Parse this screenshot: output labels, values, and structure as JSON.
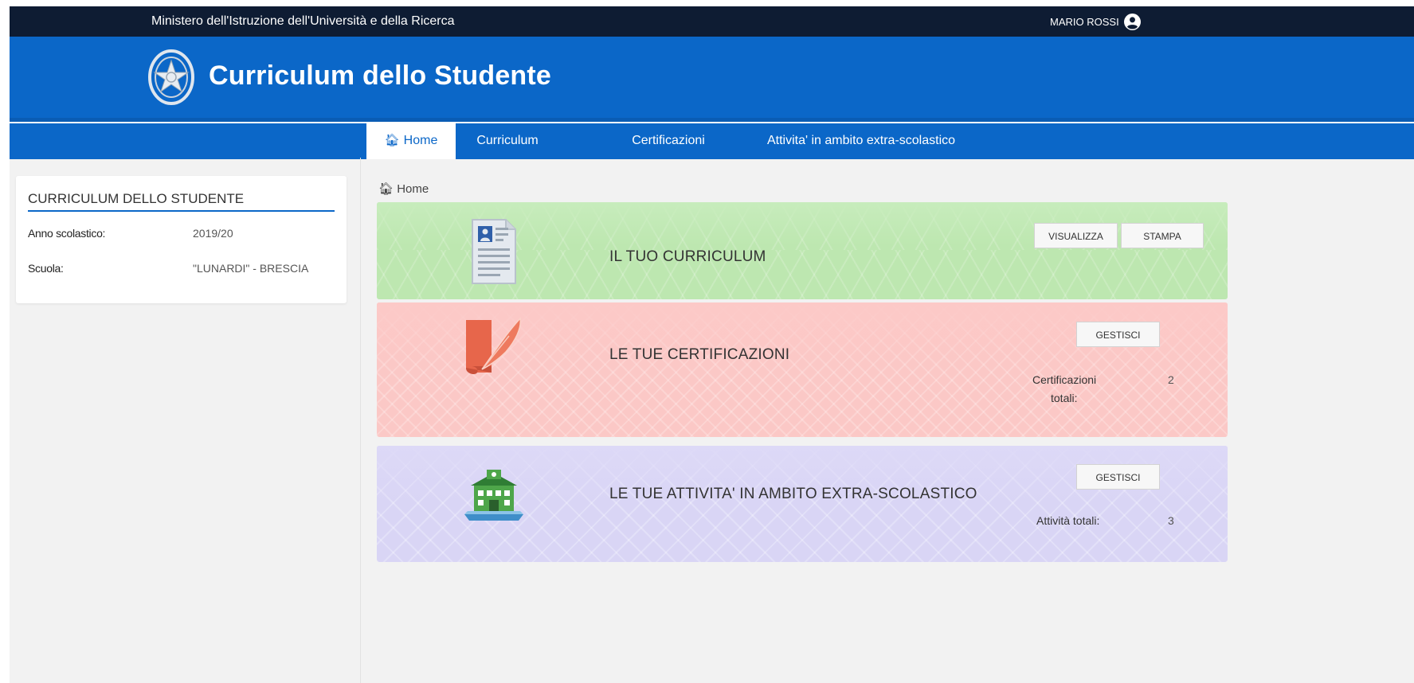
{
  "topbar": {
    "ministry": "Ministero dell'Istruzione dell'Università e della Ricerca",
    "user_name": "MARIO ROSSI"
  },
  "header": {
    "app_title": "Curriculum dello Studente"
  },
  "nav": {
    "items": [
      {
        "label": "Home",
        "active": true
      },
      {
        "label": "Curriculum",
        "active": false
      },
      {
        "label": "Certificazioni",
        "active": false
      },
      {
        "label": "Attivita' in ambito extra-scolastico",
        "active": false
      }
    ]
  },
  "sidebar": {
    "title": "CURRICULUM DELLO STUDENTE",
    "rows": [
      {
        "label": "Anno scolastico:",
        "value": "2019/20"
      },
      {
        "label": "Scuola:",
        "value": "\"LUNARDI\" - BRESCIA"
      }
    ]
  },
  "breadcrumb": {
    "label": "Home"
  },
  "panels": {
    "curriculum": {
      "title": "IL TUO CURRICULUM",
      "buttons": [
        "VISUALIZZA",
        "STAMPA"
      ],
      "color": "#bde7b0"
    },
    "certificazioni": {
      "title": "LE TUE CERTIFICAZIONI",
      "button": "GESTISCI",
      "stat_label_1": "Certificazioni",
      "stat_label_2": "totali:",
      "stat_value": "2",
      "color": "#fbc8c6"
    },
    "attivita": {
      "title": "LE TUE ATTIVITA' IN AMBITO EXTRA-SCOLASTICO",
      "button": "GESTISCI",
      "stat_label": "Attività totali:",
      "stat_value": "3",
      "color": "#d9d5f5"
    }
  },
  "colors": {
    "topbar": "#0e1c33",
    "brand_blue": "#0b67c8"
  },
  "icons": {
    "user": "user-circle-icon",
    "emblem": "emblem-icon",
    "home": "home-icon",
    "curriculum": "document-icon",
    "certificazioni": "scroll-quill-icon",
    "attivita": "school-building-icon"
  }
}
